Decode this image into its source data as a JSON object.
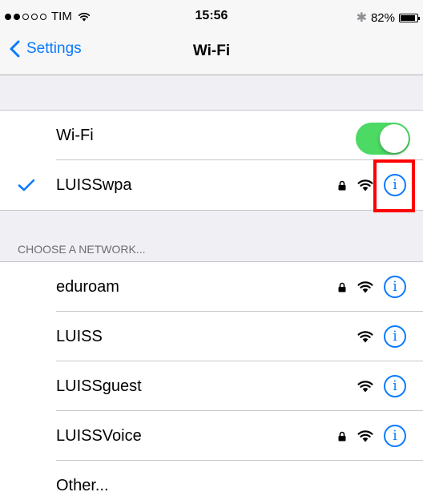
{
  "status_bar": {
    "carrier": "TIM",
    "time": "15:56",
    "battery": "82%",
    "battery_level": 0.82,
    "signal_bars_filled": 2,
    "signal_bars_total": 5
  },
  "nav": {
    "back_label": "Settings",
    "title": "Wi-Fi"
  },
  "wifi_toggle": {
    "label": "Wi-Fi",
    "state": "on"
  },
  "connected_network": {
    "name": "LUISSwpa",
    "secured": true,
    "info_glyph": "i",
    "highlighted": true
  },
  "networks_header": "CHOOSE A NETWORK...",
  "networks": [
    {
      "name": "eduroam",
      "secured": true,
      "info_glyph": "i"
    },
    {
      "name": "LUISS",
      "secured": false,
      "info_glyph": "i"
    },
    {
      "name": "LUISSguest",
      "secured": false,
      "info_glyph": "i"
    },
    {
      "name": "LUISSVoice",
      "secured": true,
      "info_glyph": "i"
    }
  ],
  "other_label": "Other...",
  "icons": {
    "back": "chevron-left-icon",
    "checkmark": "checkmark-icon",
    "lock": "lock-icon",
    "wifi": "wifi-icon",
    "info": "info-icon",
    "bluetooth": "bluetooth-icon",
    "battery": "battery-icon"
  },
  "colors": {
    "accent": "#0a7aff",
    "toggle_on": "#4cd964",
    "highlight": "#ff0000",
    "background": "#efeff4",
    "section_text": "#6d6d72"
  }
}
